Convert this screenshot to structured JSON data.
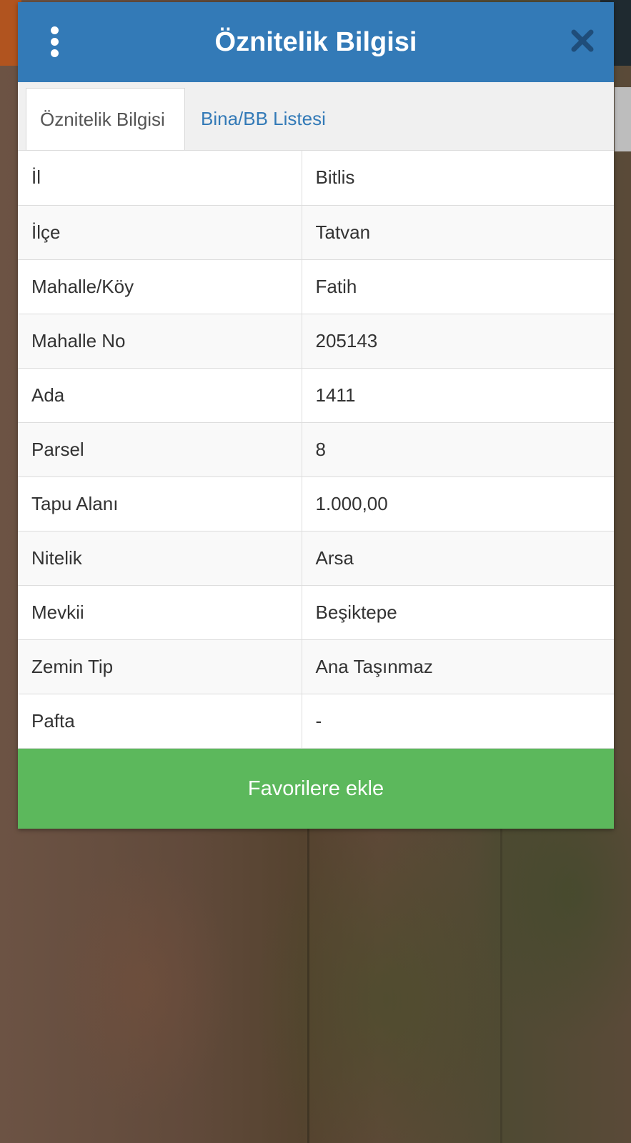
{
  "header": {
    "title": "Öznitelik Bilgisi",
    "menu_icon": "more-vertical-icon",
    "close_icon": "close-icon"
  },
  "tabs": [
    {
      "label": "Öznitelik Bilgisi",
      "active": true
    },
    {
      "label": "Bina/BB Listesi",
      "active": false
    }
  ],
  "rows": [
    {
      "key": "İl",
      "value": "Bitlis"
    },
    {
      "key": "İlçe",
      "value": "Tatvan"
    },
    {
      "key": "Mahalle/Köy",
      "value": "Fatih"
    },
    {
      "key": "Mahalle No",
      "value": "205143"
    },
    {
      "key": "Ada",
      "value": "1411"
    },
    {
      "key": "Parsel",
      "value": "8"
    },
    {
      "key": "Tapu Alanı",
      "value": "1.000,00"
    },
    {
      "key": "Nitelik",
      "value": "Arsa"
    },
    {
      "key": "Mevkii",
      "value": "Beşiktepe"
    },
    {
      "key": "Zemin Tip",
      "value": "Ana Taşınmaz"
    },
    {
      "key": "Pafta",
      "value": "-"
    }
  ],
  "actions": {
    "favorite_label": "Favorilere ekle"
  },
  "colors": {
    "header_bg": "#337ab7",
    "tab_link": "#337ab7",
    "favorite_button": "#5cb85c"
  }
}
